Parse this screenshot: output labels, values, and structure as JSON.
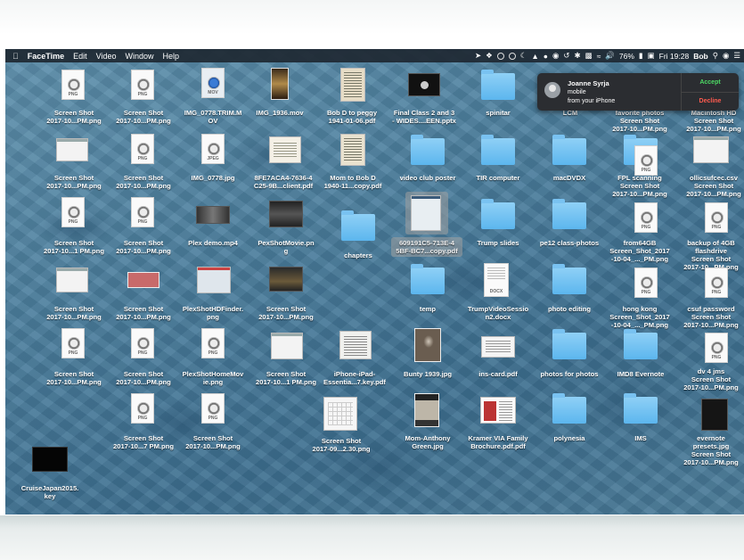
{
  "menubar": {
    "app": "FaceTime",
    "menus": [
      "Edit",
      "Video",
      "Window",
      "Help"
    ],
    "battery": "76%",
    "clock": "Fri 19:28",
    "user": "Bob"
  },
  "notification": {
    "caller": "Joanne Syrja",
    "line2": "mobile",
    "line3": "from your iPhone",
    "accept": "Accept",
    "decline": "Decline"
  },
  "desktop": {
    "labels": {
      "r1c1a": "Screen Shot",
      "r1c1b": "2017-10...PM.png",
      "r1c2a": "Screen Shot",
      "r1c2b": "2017-10...PM.png",
      "r1c3a": "IMG_0778.TRIM.M",
      "r1c3b": "OV",
      "r1c4a": "IMG_1936.mov",
      "r1c5a": "Bob D to peggy",
      "r1c5b": "1941-01-06.pdf",
      "r1c6a": "Final Class 2 and 3",
      "r1c6b": "- WIDES....EEN.pptx",
      "r1c7a": "spinitar",
      "r1c8a": "LCM",
      "r1c9a": "favorite photos",
      "r1c9b": "Screen Shot",
      "r1c9c": "2017-10...PM.png",
      "r1c10a": "Macintosh HD",
      "r1c10b": "Screen Shot",
      "r1c10c": "2017-10...PM.png",
      "r2c1a": "Screen Shot",
      "r2c1b": "2017-10...PM.png",
      "r2c2a": "Screen Shot",
      "r2c2b": "2017-10...PM.png",
      "r2c3a": "IMG_0778.jpg",
      "r2c4a": "8FE7ACA4-7636-4",
      "r2c4b": "C25-9B...client.pdf",
      "r2c5a": "Mom to Bob D",
      "r2c5b": "1940-11...copy.pdf",
      "r2c6a": "video club poster",
      "r2c7a": "TIR computer",
      "r2c8a": "macDVDX",
      "r2c9a": "FPL scanning",
      "r2c9b": "Screen Shot",
      "r2c9c": "2017-10...PM.png",
      "r2c10a": "ollicsufcec.csv",
      "r2c10b": "Screen Shot",
      "r2c10c": "2017-10...PM.png",
      "r3c1a": "Screen Shot",
      "r3c1b": "2017-10...1 PM.png",
      "r3c2a": "Screen Shot",
      "r3c2b": "2017-10...PM.png",
      "r3c3a": "Plex demo.mp4",
      "r3c4a": "PexShotMovie.pn",
      "r3c4b": "g",
      "r3c5a": "chapters",
      "r3c6a": "609191C5-713E-4",
      "r3c6b": "5BF-BC7...copy.pdf",
      "r3c7a": "Trump slides",
      "r3c8a": "pe12 class-photos",
      "r3c9a": "from64GB",
      "r3c9b": "Screen_Shot_2017",
      "r3c9c": "-10-04_..._PM.png",
      "r3c10a": "backup of 4GB",
      "r3c10b": "flashdrive",
      "r3c10c": "Screen Shot",
      "r3c10d": "2017-10...PM.png",
      "r4c1a": "Screen Shot",
      "r4c1b": "2017-10...PM.png",
      "r4c2a": "Screen Shot",
      "r4c2b": "2017-10...PM.png",
      "r4c3a": "PlexShotHDFinder.",
      "r4c3b": "png",
      "r4c4a": "Screen Shot",
      "r4c4b": "2017-10...PM.png",
      "r4c5a": "temp",
      "r4c6a": "TrumpVideoSessio",
      "r4c6b": "n2.docx",
      "r4c7a": "photo editing",
      "r4c9a": "hong kong",
      "r4c9b": "Screen_Shot_2017",
      "r4c9c": "-10-04_..._PM.png",
      "r4c10a": "csuf password",
      "r4c10b": "Screen Shot",
      "r4c10c": "2017-10...PM.png",
      "r5c1a": "Screen Shot",
      "r5c1b": "2017-10...PM.png",
      "r5c2a": "Screen Shot",
      "r5c2b": "2017-10...PM.png",
      "r5c3a": "PlexShotHomeMov",
      "r5c3b": "ie.png",
      "r5c4a": "Screen Shot",
      "r5c4b": "2017-10...1 PM.png",
      "r5c5a": "iPhone-iPad-",
      "r5c5b": "Essentia...7.key.pdf",
      "r5c6a": "Bunty 1939.jpg",
      "r5c7a": "ins-card.pdf",
      "r5c8a": "photos for photos",
      "r5c9a": "IMD8 Evernote",
      "r5c10a": "dv 4 jms",
      "r5c10b": "Screen Shot",
      "r5c10c": "2017-10...PM.png",
      "r6c2a": "Screen Shot",
      "r6c2b": "2017-10...7 PM.png",
      "r6c3a": "Screen Shot",
      "r6c3b": "2017-10...PM.png",
      "r6c5a": "Screen Shot",
      "r6c5b": "2017-09...2.30.png",
      "r6c6a": "Mom-Anthony",
      "r6c6b": "Green.jpg",
      "r6c7a": "Kramer VIA Family",
      "r6c7b": "Brochure.pdf.pdf",
      "r6c8a": "polynesia",
      "r6c9a": "IMS",
      "r6c10a": "evernote",
      "r6c10b": "presets.jpg",
      "r6c10c": "Screen Shot",
      "r6c10d": "2017-10...PM.png",
      "r7c1a": "CruiseJapan2015.",
      "r7c1b": "key"
    },
    "tags": {
      "png": "PNG",
      "mov": "MOV",
      "jpeg": "JPEG",
      "docx": "DOCX"
    }
  }
}
